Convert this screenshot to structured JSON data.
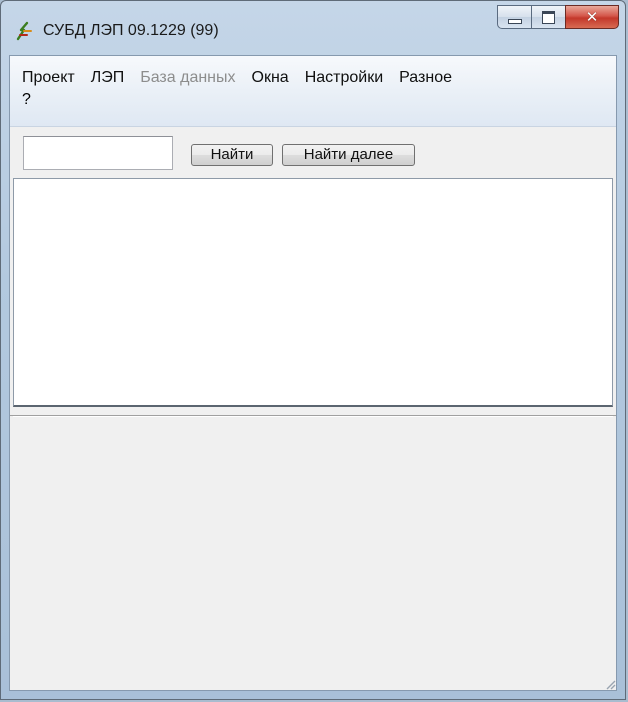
{
  "window": {
    "title": "СУБД ЛЭП 09.1229 (99)",
    "app_icon": "power-line-icon",
    "caption": {
      "minimize_icon": "minimize-icon",
      "maximize_icon": "maximize-icon",
      "close_icon": "close-icon",
      "close_glyph": "✕"
    }
  },
  "menu": {
    "items": [
      {
        "label": "Проект",
        "enabled": true
      },
      {
        "label": "ЛЭП",
        "enabled": true
      },
      {
        "label": "База данных",
        "enabled": false
      },
      {
        "label": "Окна",
        "enabled": true
      },
      {
        "label": "Настройки",
        "enabled": true
      },
      {
        "label": "Разное",
        "enabled": true
      }
    ],
    "help_label": "?"
  },
  "toolbar": {
    "search_value": "",
    "find_label": "Найти",
    "find_next_label": "Найти далее"
  },
  "colors": {
    "accent_close": "#c3382a",
    "client_bg": "#f0f0f0",
    "disabled_text": "#8d8d8d"
  }
}
